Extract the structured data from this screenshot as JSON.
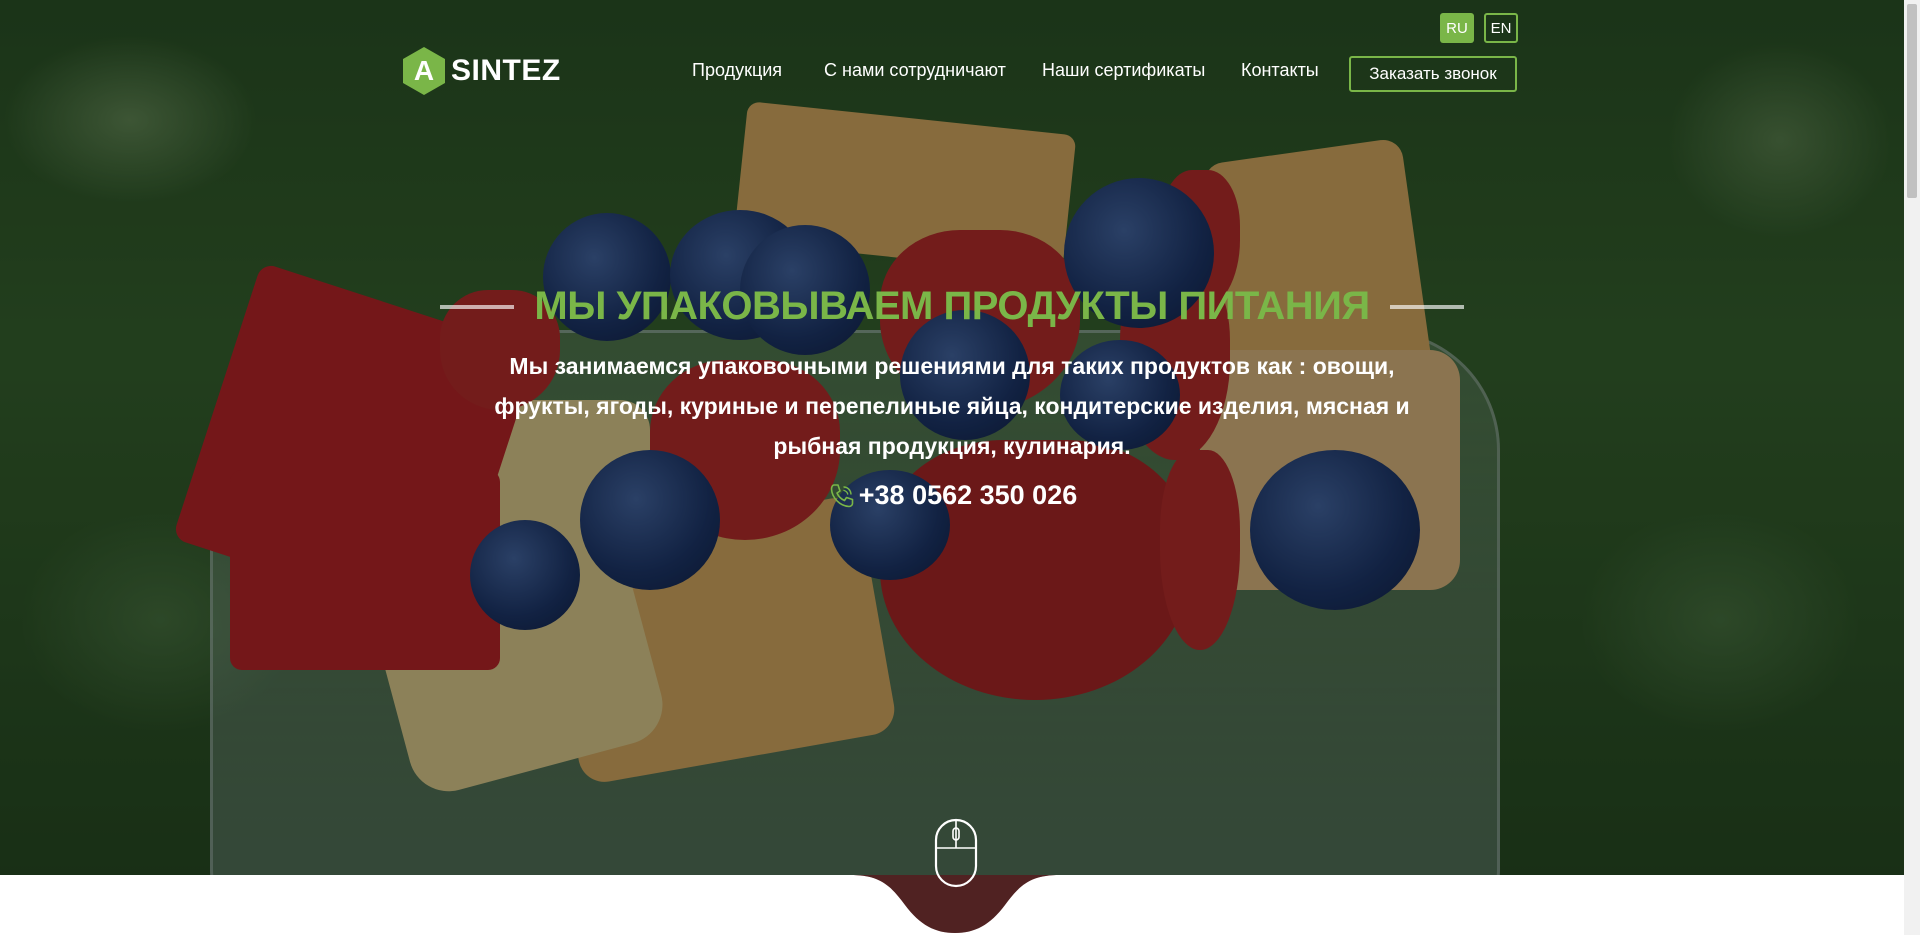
{
  "header": {
    "languages": [
      {
        "code": "RU",
        "active": true
      },
      {
        "code": "EN",
        "active": false
      }
    ],
    "logo": {
      "mark": "A",
      "text": "SINTEZ"
    },
    "nav": [
      {
        "label": "Продукция"
      },
      {
        "label": "С нами сотрудничают"
      },
      {
        "label": "Наши сертификаты"
      },
      {
        "label": "Контакты"
      }
    ],
    "cta_label": "Заказать звонок"
  },
  "hero": {
    "title": "МЫ УПАКОВЫВАЕМ ПРОДУКТЫ ПИТАНИЯ",
    "description": "Мы занимаемся упаковочными решениями для таких продуктов как : овощи, фрукты, ягоды, куриные и перепелиные яйца, кондитерские изделия, мясная и рыбная продукция, кулинария.",
    "phone": "+38 0562 350 026",
    "icons": {
      "phone": "phone-icon",
      "scroll": "mouse-icon"
    }
  },
  "colors": {
    "accent": "#7ab648",
    "text": "#ffffff"
  }
}
